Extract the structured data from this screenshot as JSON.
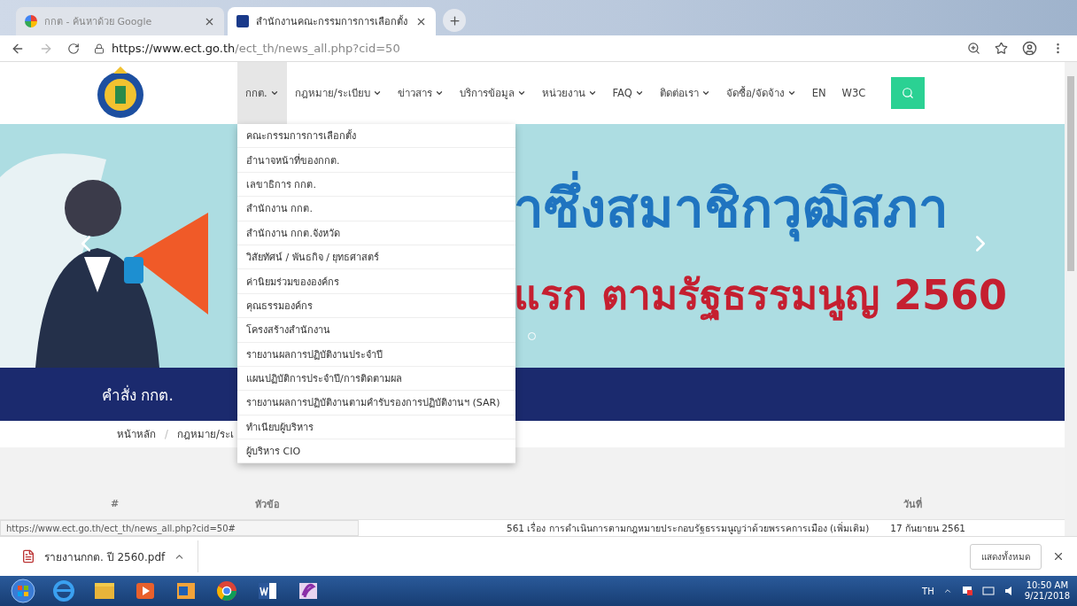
{
  "browser": {
    "tabs": [
      {
        "title": "กกต - ค้นหาด้วย Google",
        "kind": "search",
        "selected": false
      },
      {
        "title": "สำนักงานคณะกรรมการการเลือกตั้ง",
        "kind": "site",
        "selected": true
      }
    ],
    "url_host": "https://www.ect.go.th",
    "url_path": "/ect_th/news_all.php?cid=50"
  },
  "site": {
    "nav": [
      {
        "label": "กกต.",
        "dropdown": true,
        "selected": true
      },
      {
        "label": "กฎหมาย/ระเบียบ",
        "dropdown": true,
        "selected": false
      },
      {
        "label": "ข่าวสาร",
        "dropdown": true,
        "selected": false
      },
      {
        "label": "บริการข้อมูล",
        "dropdown": true,
        "selected": false
      },
      {
        "label": "หน่วยงาน",
        "dropdown": true,
        "selected": false
      },
      {
        "label": "FAQ",
        "dropdown": true,
        "selected": false
      },
      {
        "label": "ติดต่อเรา",
        "dropdown": true,
        "selected": false
      },
      {
        "label": "จัดซื้อ/จัดจ้าง",
        "dropdown": true,
        "selected": false
      },
      {
        "label": "EN",
        "dropdown": false,
        "selected": false
      },
      {
        "label": "W3C",
        "dropdown": false,
        "selected": false
      }
    ],
    "dropdown_items": [
      "คณะกรรมการการเลือกตั้ง",
      "อำนาจหน้าที่ของกกต.",
      "เลขาธิการ กกต.",
      "สำนักงาน กกต.",
      "สำนักงาน กกต.จังหวัด",
      "วิสัยทัศน์ / พันธกิจ / ยุทธศาสตร์",
      "ค่านิยมร่วมขององค์กร",
      "คุณธรรมองค์กร",
      "โครงสร้างสำนักงาน",
      "รายงานผลการปฏิบัติงานประจำปี",
      "แผนปฏิบัติการประจำปี/การติดตามผล",
      "รายงานผลการปฏิบัติงานตามคำรับรองการปฏิบัติงานฯ (SAR)",
      "ทำเนียบผู้บริหาร",
      "ผู้บริหาร CIO"
    ],
    "banner": {
      "line_1": "าซึ่งสมาชิกวุฒิสภา",
      "line_2": "แรก ตามรัฐธรรมนูญ 2560"
    },
    "section_title": "คำสั่ง กกต.",
    "breadcrumb": [
      "หน้าหลัก",
      "กฎหมาย/ระเ"
    ],
    "breadcrumb_separator": "/",
    "table": {
      "columns": [
        "#",
        "หัวข้อ",
        "วันที่"
      ],
      "rows": [
        {
          "topic": "561 เรื่อง การดำเนินการตามกฎหมายประกอบรัฐธรรมนูญว่าด้วยพรรคการเมือง (เพิ่มเติม)",
          "date": "17 กันยายน 2561"
        }
      ]
    }
  },
  "status_url": "https://www.ect.go.th/ect_th/news_all.php?cid=50#",
  "downloads": {
    "file": "รายงานกกต. ปี 2560.pdf",
    "show_all": "แสดงทั้งหมด"
  },
  "taskbar": {
    "language": "TH",
    "time": "10:50 AM",
    "date": "9/21/2018"
  }
}
